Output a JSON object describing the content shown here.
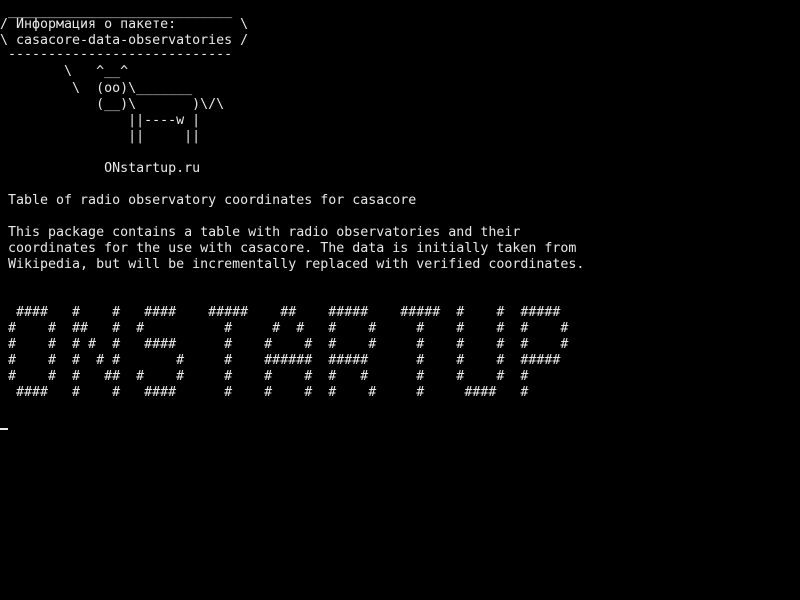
{
  "terminal": {
    "colors": {
      "background": "#000000",
      "foreground": "#e8e8e8"
    },
    "cowsay": {
      "bubble_top": " ____________________________",
      "bubble_line1": "/ Информация о пакете:        \\",
      "bubble_line2": "\\ casacore-data-observatories /",
      "bubble_bottom": " ----------------------------",
      "cow_line1": "        \\   ^__^",
      "cow_line2": "         \\  (oo)\\_______",
      "cow_line3": "            (__)\\       )\\/\\",
      "cow_line4": "                ||----w |",
      "cow_line5": "                ||     ||",
      "site": "             ONstartup.ru"
    },
    "package": {
      "summary": " Table of radio observatory coordinates for casacore",
      "description_line1": " This package contains a table with radio observatories and their",
      "description_line2": " coordinates for the use with casacore. The data is initially taken from",
      "description_line3": " Wikipedia, but will be incrementally replaced with verified coordinates."
    },
    "banner": {
      "line1": "  ####   #    #   ####    #####    ##    #####    #####  #    #  #####",
      "line2": " #    #  ##   #  #          #     #  #   #    #     #    #    #  #    #",
      "line3": " #    #  # #  #   ####      #    #    #  #    #     #    #    #  #    #",
      "line4": " #    #  #  # #       #     #    ######  #####      #    #    #  #####",
      "line5": " #    #  #   ##  #    #     #    #    #  #   #      #    #    #  #",
      "line6": "  ####   #    #   ####      #    #    #  #    #     #     ####   #"
    }
  }
}
